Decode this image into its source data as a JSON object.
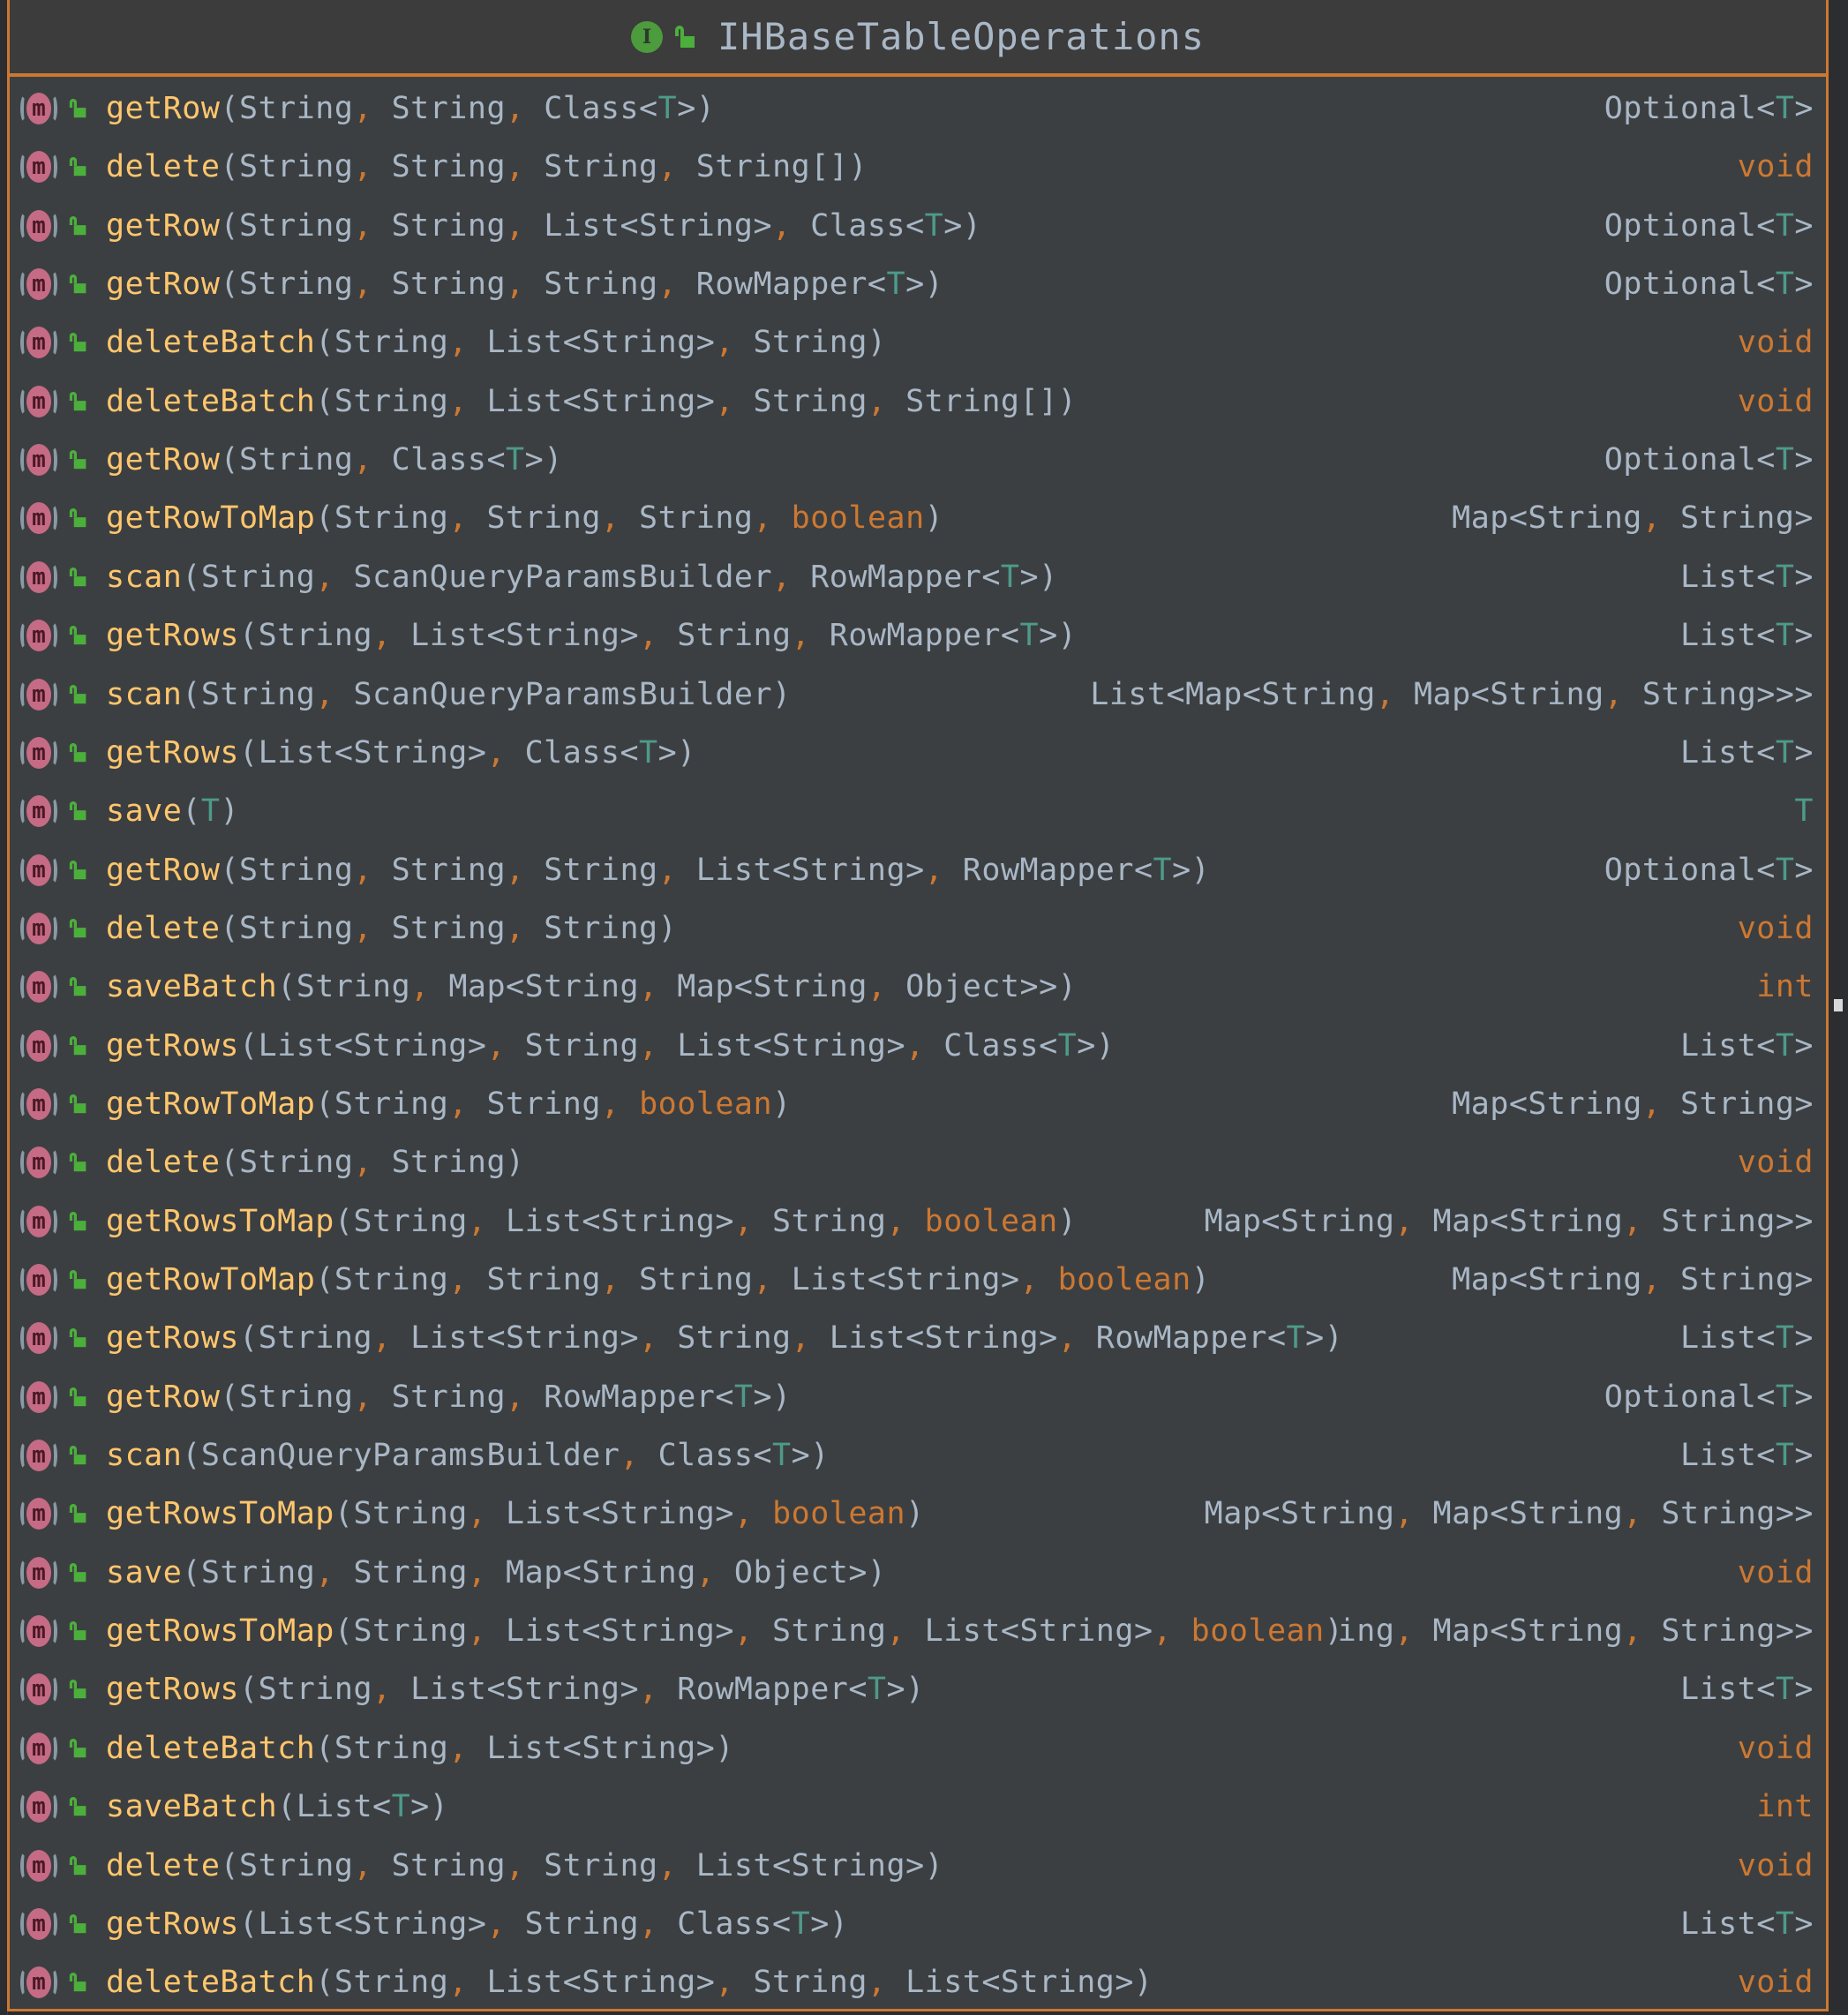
{
  "window": {
    "title": "IHBaseTableOperations",
    "kind_icon": "interface-icon",
    "kind_letter": "I",
    "visibility_icon": "public-lock-open-icon"
  },
  "colors": {
    "border_accent": "#cc7832",
    "method_name": "#ffc66d",
    "default_text": "#a9b7c6",
    "keyword": "#cc7832",
    "type_param": "#4e9a8a",
    "method_icon": "#c56b85",
    "interface_icon": "#4c9b3d",
    "lock_icon": "#4caf3c"
  },
  "methods": [
    {
      "icon": "method-icon",
      "letter": "m",
      "signature": "getRow(String, String, Class<T>)",
      "return_type": "Optional<T>"
    },
    {
      "icon": "method-icon",
      "letter": "m",
      "signature": "delete(String, String, String, String[])",
      "return_type": "void"
    },
    {
      "icon": "method-icon",
      "letter": "m",
      "signature": "getRow(String, String, List<String>, Class<T>)",
      "return_type": "Optional<T>"
    },
    {
      "icon": "method-icon",
      "letter": "m",
      "signature": "getRow(String, String, String, RowMapper<T>)",
      "return_type": "Optional<T>"
    },
    {
      "icon": "method-icon",
      "letter": "m",
      "signature": "deleteBatch(String, List<String>, String)",
      "return_type": "void"
    },
    {
      "icon": "method-icon",
      "letter": "m",
      "signature": "deleteBatch(String, List<String>, String, String[])",
      "return_type": "void"
    },
    {
      "icon": "method-icon",
      "letter": "m",
      "signature": "getRow(String, Class<T>)",
      "return_type": "Optional<T>"
    },
    {
      "icon": "method-icon",
      "letter": "m",
      "signature": "getRowToMap(String, String, String, boolean)",
      "return_type": "Map<String, String>"
    },
    {
      "icon": "method-icon",
      "letter": "m",
      "signature": "scan(String, ScanQueryParamsBuilder, RowMapper<T>)",
      "return_type": "List<T>"
    },
    {
      "icon": "method-icon",
      "letter": "m",
      "signature": "getRows(String, List<String>, String, RowMapper<T>)",
      "return_type": "List<T>"
    },
    {
      "icon": "method-icon",
      "letter": "m",
      "signature": "scan(String, ScanQueryParamsBuilder)",
      "return_type": "List<Map<String, Map<String, String>>>"
    },
    {
      "icon": "method-icon",
      "letter": "m",
      "signature": "getRows(List<String>, Class<T>)",
      "return_type": "List<T>"
    },
    {
      "icon": "method-icon",
      "letter": "m",
      "signature": "save(T)",
      "return_type": "T"
    },
    {
      "icon": "method-icon",
      "letter": "m",
      "signature": "getRow(String, String, String, List<String>, RowMapper<T>)",
      "return_type": "Optional<T>"
    },
    {
      "icon": "method-icon",
      "letter": "m",
      "signature": "delete(String, String, String)",
      "return_type": "void"
    },
    {
      "icon": "method-icon",
      "letter": "m",
      "signature": "saveBatch(String, Map<String, Map<String, Object>>)",
      "return_type": "int"
    },
    {
      "icon": "method-icon",
      "letter": "m",
      "signature": "getRows(List<String>, String, List<String>, Class<T>)",
      "return_type": "List<T>"
    },
    {
      "icon": "method-icon",
      "letter": "m",
      "signature": "getRowToMap(String, String, boolean)",
      "return_type": "Map<String, String>"
    },
    {
      "icon": "method-icon",
      "letter": "m",
      "signature": "delete(String, String)",
      "return_type": "void"
    },
    {
      "icon": "method-icon",
      "letter": "m",
      "signature": "getRowsToMap(String, List<String>, String, boolean)",
      "return_type": "Map<String, Map<String, String>>"
    },
    {
      "icon": "method-icon",
      "letter": "m",
      "signature": "getRowToMap(String, String, String, List<String>, boolean)",
      "return_type": "Map<String, String>"
    },
    {
      "icon": "method-icon",
      "letter": "m",
      "signature": "getRows(String, List<String>, String, List<String>, RowMapper<T>)",
      "return_type": "List<T>"
    },
    {
      "icon": "method-icon",
      "letter": "m",
      "signature": "getRow(String, String, RowMapper<T>)",
      "return_type": "Optional<T>"
    },
    {
      "icon": "method-icon",
      "letter": "m",
      "signature": "scan(ScanQueryParamsBuilder, Class<T>)",
      "return_type": "List<T>"
    },
    {
      "icon": "method-icon",
      "letter": "m",
      "signature": "getRowsToMap(String, List<String>, boolean)",
      "return_type": "Map<String, Map<String, String>>"
    },
    {
      "icon": "method-icon",
      "letter": "m",
      "signature": "save(String, String, Map<String, Object>)",
      "return_type": "void"
    },
    {
      "icon": "method-icon",
      "letter": "m",
      "signature": "getRowsToMap(String, List<String>, String, List<String>, boolean)",
      "return_type": "ing, Map<String, String>>"
    },
    {
      "icon": "method-icon",
      "letter": "m",
      "signature": "getRows(String, List<String>, RowMapper<T>)",
      "return_type": "List<T>"
    },
    {
      "icon": "method-icon",
      "letter": "m",
      "signature": "deleteBatch(String, List<String>)",
      "return_type": "void"
    },
    {
      "icon": "method-icon",
      "letter": "m",
      "signature": "saveBatch(List<T>)",
      "return_type": "int"
    },
    {
      "icon": "method-icon",
      "letter": "m",
      "signature": "delete(String, String, String, List<String>)",
      "return_type": "void"
    },
    {
      "icon": "method-icon",
      "letter": "m",
      "signature": "getRows(List<String>, String, Class<T>)",
      "return_type": "List<T>"
    },
    {
      "icon": "method-icon",
      "letter": "m",
      "signature": "deleteBatch(String, List<String>, String, List<String>)",
      "return_type": "void"
    }
  ]
}
